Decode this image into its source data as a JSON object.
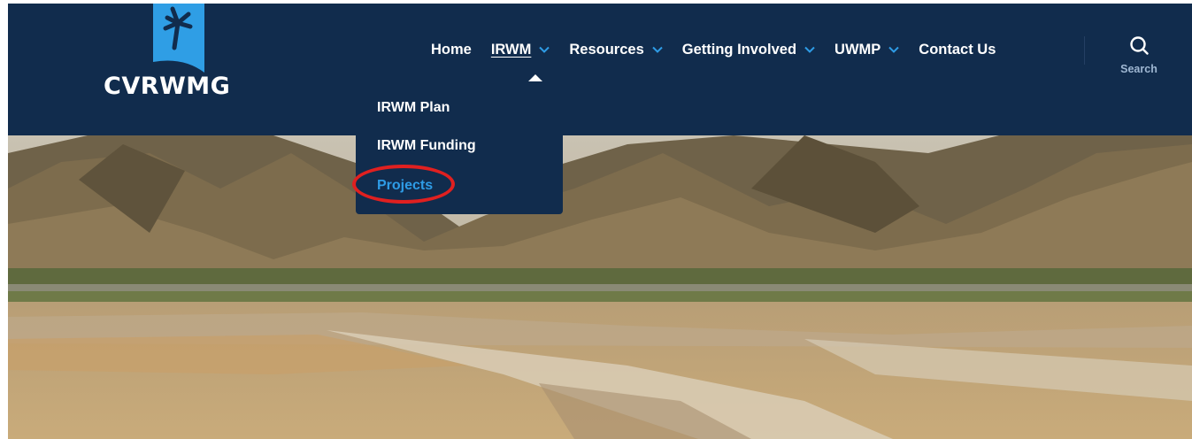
{
  "logo": {
    "text": "CVRWMG"
  },
  "nav": {
    "items": [
      {
        "label": "Home",
        "has_dropdown": false,
        "active": false
      },
      {
        "label": "IRWM",
        "has_dropdown": true,
        "active": true
      },
      {
        "label": "Resources",
        "has_dropdown": true,
        "active": false
      },
      {
        "label": "Getting Involved",
        "has_dropdown": true,
        "active": false
      },
      {
        "label": "UWMP",
        "has_dropdown": true,
        "active": false
      },
      {
        "label": "Contact Us",
        "has_dropdown": false,
        "active": false
      }
    ],
    "search_label": "Search"
  },
  "dropdown": {
    "items": [
      {
        "label": "IRWM Plan"
      },
      {
        "label": "IRWM Funding"
      },
      {
        "label": "Projects",
        "highlighted": true
      }
    ]
  },
  "colors": {
    "header_bg": "#112c4d",
    "accent": "#2e9ce6",
    "highlight_ring": "#e02020"
  },
  "icons": [
    "palm-tree-logo-icon",
    "chevron-down-icon",
    "search-icon",
    "caret-up-icon"
  ]
}
